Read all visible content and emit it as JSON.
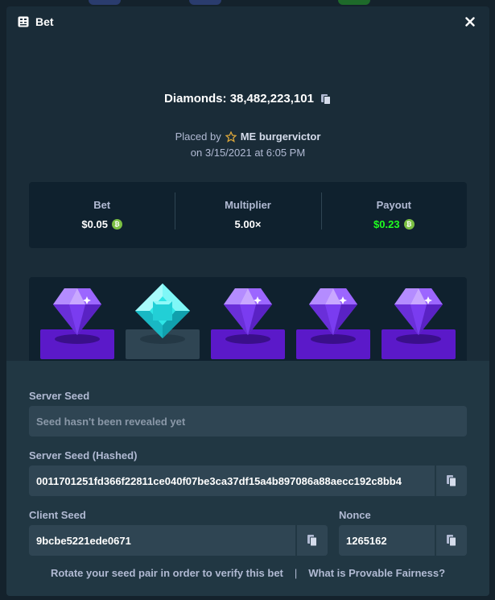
{
  "modal": {
    "title": "Bet",
    "close_icon": "close-icon"
  },
  "bet": {
    "amount_line": "Diamonds: 38,482,223,101",
    "placed_by_prefix": "Placed by",
    "username": "ME burgervictor",
    "date_line": "on 3/15/2021 at 6:05 PM"
  },
  "stats": [
    {
      "label": "Bet",
      "value": "$0.05",
      "coin": true,
      "color": "#ffffff"
    },
    {
      "label": "Multiplier",
      "value": "5.00×",
      "coin": false,
      "color": "#ffffff"
    },
    {
      "label": "Payout",
      "value": "$0.23",
      "coin": true,
      "color": "#1fff20"
    }
  ],
  "gems": [
    {
      "type": "purple-diamond",
      "pad_color": "#5b19c9",
      "shadow_color": "#3a0f8a"
    },
    {
      "type": "cyan-diamond",
      "pad_color": "#2f4553",
      "shadow_color": "#243845"
    },
    {
      "type": "purple-diamond",
      "pad_color": "#5b19c9",
      "shadow_color": "#3a0f8a"
    },
    {
      "type": "purple-diamond",
      "pad_color": "#5b19c9",
      "shadow_color": "#3a0f8a"
    },
    {
      "type": "purple-diamond",
      "pad_color": "#5b19c9",
      "shadow_color": "#3a0f8a"
    }
  ],
  "fairness": {
    "server_seed_label": "Server Seed",
    "server_seed_placeholder": "Seed hasn't been revealed yet",
    "server_seed_hashed_label": "Server Seed (Hashed)",
    "server_seed_hashed_value": "0011701251fd366f22811ce040f07be3ca37df15a4b897086a88aecc192c8bb4",
    "client_seed_label": "Client Seed",
    "client_seed_value": "9bcbe5221ede0671",
    "nonce_label": "Nonce",
    "nonce_value": "1265162",
    "rotate_link": "Rotate your seed pair in order to verify this bet",
    "separator": "|",
    "fairness_link": "What is Provable Fairness?"
  }
}
